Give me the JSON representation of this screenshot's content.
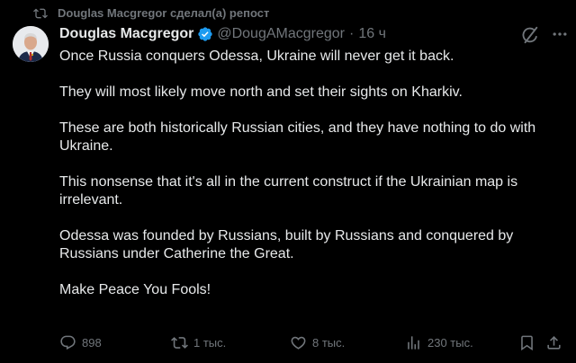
{
  "repost": {
    "text": "Douglas Macgregor сделал(а) репост"
  },
  "author": {
    "display_name": "Douglas Macgregor",
    "handle": "@DougAMacgregor",
    "separator": "·",
    "time": "16 ч",
    "verified": true
  },
  "icons": {
    "repost": "repost-icon",
    "verified": "verified-badge-icon",
    "grok": "grok-icon",
    "more": "more-options-icon",
    "reply": "reply-icon",
    "retweet": "retweet-icon",
    "like": "heart-icon",
    "views": "views-icon",
    "bookmark": "bookmark-icon",
    "share": "share-icon"
  },
  "tweet": {
    "paragraphs": [
      "Once Russia conquers Odessa, Ukraine will never get it back.",
      "They will most likely move north and set their sights on Kharkiv.",
      "These are both historically Russian cities, and they have nothing to do with Ukraine.",
      "This nonsense that it's all in the current construct if the Ukrainian map is irrelevant.",
      "Odessa was founded by Russians, built by Russians and conquered by Russians under Catherine the Great.",
      "Make Peace You Fools!"
    ]
  },
  "metrics": {
    "replies": "898",
    "reposts": "1 тыс.",
    "likes": "8 тыс.",
    "views": "230 тыс."
  },
  "colors": {
    "background": "#000000",
    "text": "#e7e9ea",
    "muted": "#71767b",
    "verified": "#1d9bf0"
  }
}
